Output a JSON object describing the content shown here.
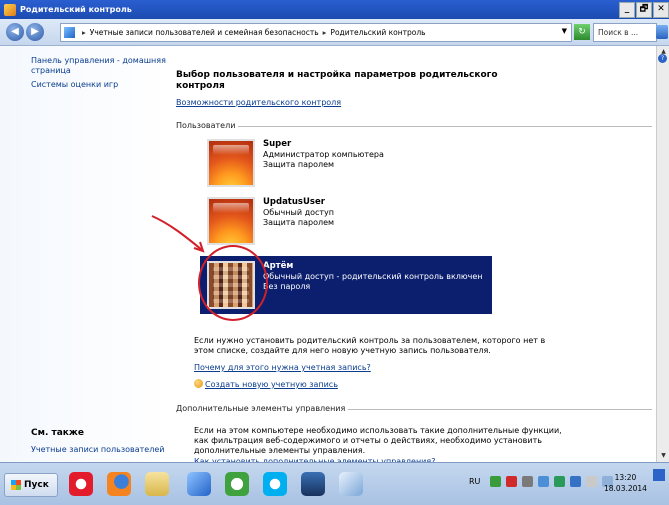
{
  "window": {
    "title": "Родительский контроль",
    "buttons": [
      "_",
      "🗗",
      "✕"
    ]
  },
  "address": {
    "breadcrumbs": [
      "Учетные записи пользователей и семейная безопасность",
      "Родительский контроль"
    ],
    "search_placeholder": "Поиск в ..."
  },
  "left_pane": {
    "links": [
      "Панель управления - домашняя страница",
      "Системы оценки игр"
    ],
    "see_also_title": "См. также",
    "see_also_links": [
      "Учетные записи пользователей"
    ]
  },
  "main": {
    "heading": "Выбор пользователя и настройка параметров родительского контроля",
    "features_link": "Возможности родительского контроля",
    "users_section": "Пользователи",
    "users": [
      {
        "name": "Super",
        "line1": "Администратор компьютера",
        "line2": "Защита паролем",
        "selected": false
      },
      {
        "name": "UpdatusUser",
        "line1": "Обычный доступ",
        "line2": "Защита паролем",
        "selected": false
      },
      {
        "name": "Артём",
        "line1": "Обычный доступ - родительский контроль включен",
        "line2": "Без пароля",
        "selected": true
      }
    ],
    "no_user_text": "Если нужно установить родительский контроль за пользователем, которого нет в этом списке, создайте для него новую учетную запись пользователя.",
    "why_link": "Почему для этого нужна учетная запись?",
    "create_link": "Создать новую учетную запись",
    "extra_section": "Дополнительные элементы управления",
    "extra_text": "Если на этом компьютере необходимо использовать такие дополнительные функции, как фильтрация веб-содержимого и отчеты о действиях, необходимо установить дополнительные элементы управления.",
    "how_link": "Как установить дополнительные элементы управления?"
  },
  "taskbar": {
    "start_label": "Пуск",
    "language": "RU",
    "time": "13:20",
    "date": "18.03.2014"
  }
}
